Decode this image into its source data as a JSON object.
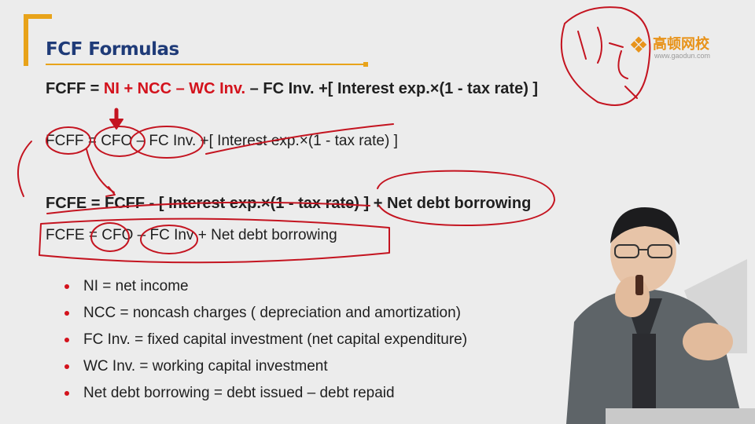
{
  "slide": {
    "title": "FCF Formulas",
    "logo": {
      "name": "高顿网校",
      "url": "www.gaodun.com"
    },
    "formulas": {
      "fcff_full": {
        "lhs": "FCFF = ",
        "highlight": "NI + NCC – WC Inv.",
        "rest": " – FC Inv. +[ Interest exp.×(1 - tax rate) ]"
      },
      "fcff_cfo": "FCFF = CFO – FC Inv. +[ Interest exp.×(1 - tax rate) ]",
      "fcfe_full": "FCFE = FCFF - [ Interest exp.×(1 - tax rate) ] + Net debt borrowing",
      "fcfe_cfo": "FCFE = CFO – FC Inv + Net debt borrowing"
    },
    "definitions": [
      "NI = net income",
      "NCC = noncash charges ( depreciation and amortization)",
      "FC Inv. = fixed capital investment (net capital expenditure)",
      "WC Inv. = working capital investment",
      "Net debt borrowing = debt issued – debt repaid"
    ]
  },
  "colors": {
    "accent_orange": "#e8a31a",
    "title_blue": "#1f3b78",
    "highlight_red": "#d3121c",
    "annotation_red": "#c41420",
    "background": "#ececec"
  },
  "icons": {
    "logo_mark": "gaodun-logo-icon"
  }
}
